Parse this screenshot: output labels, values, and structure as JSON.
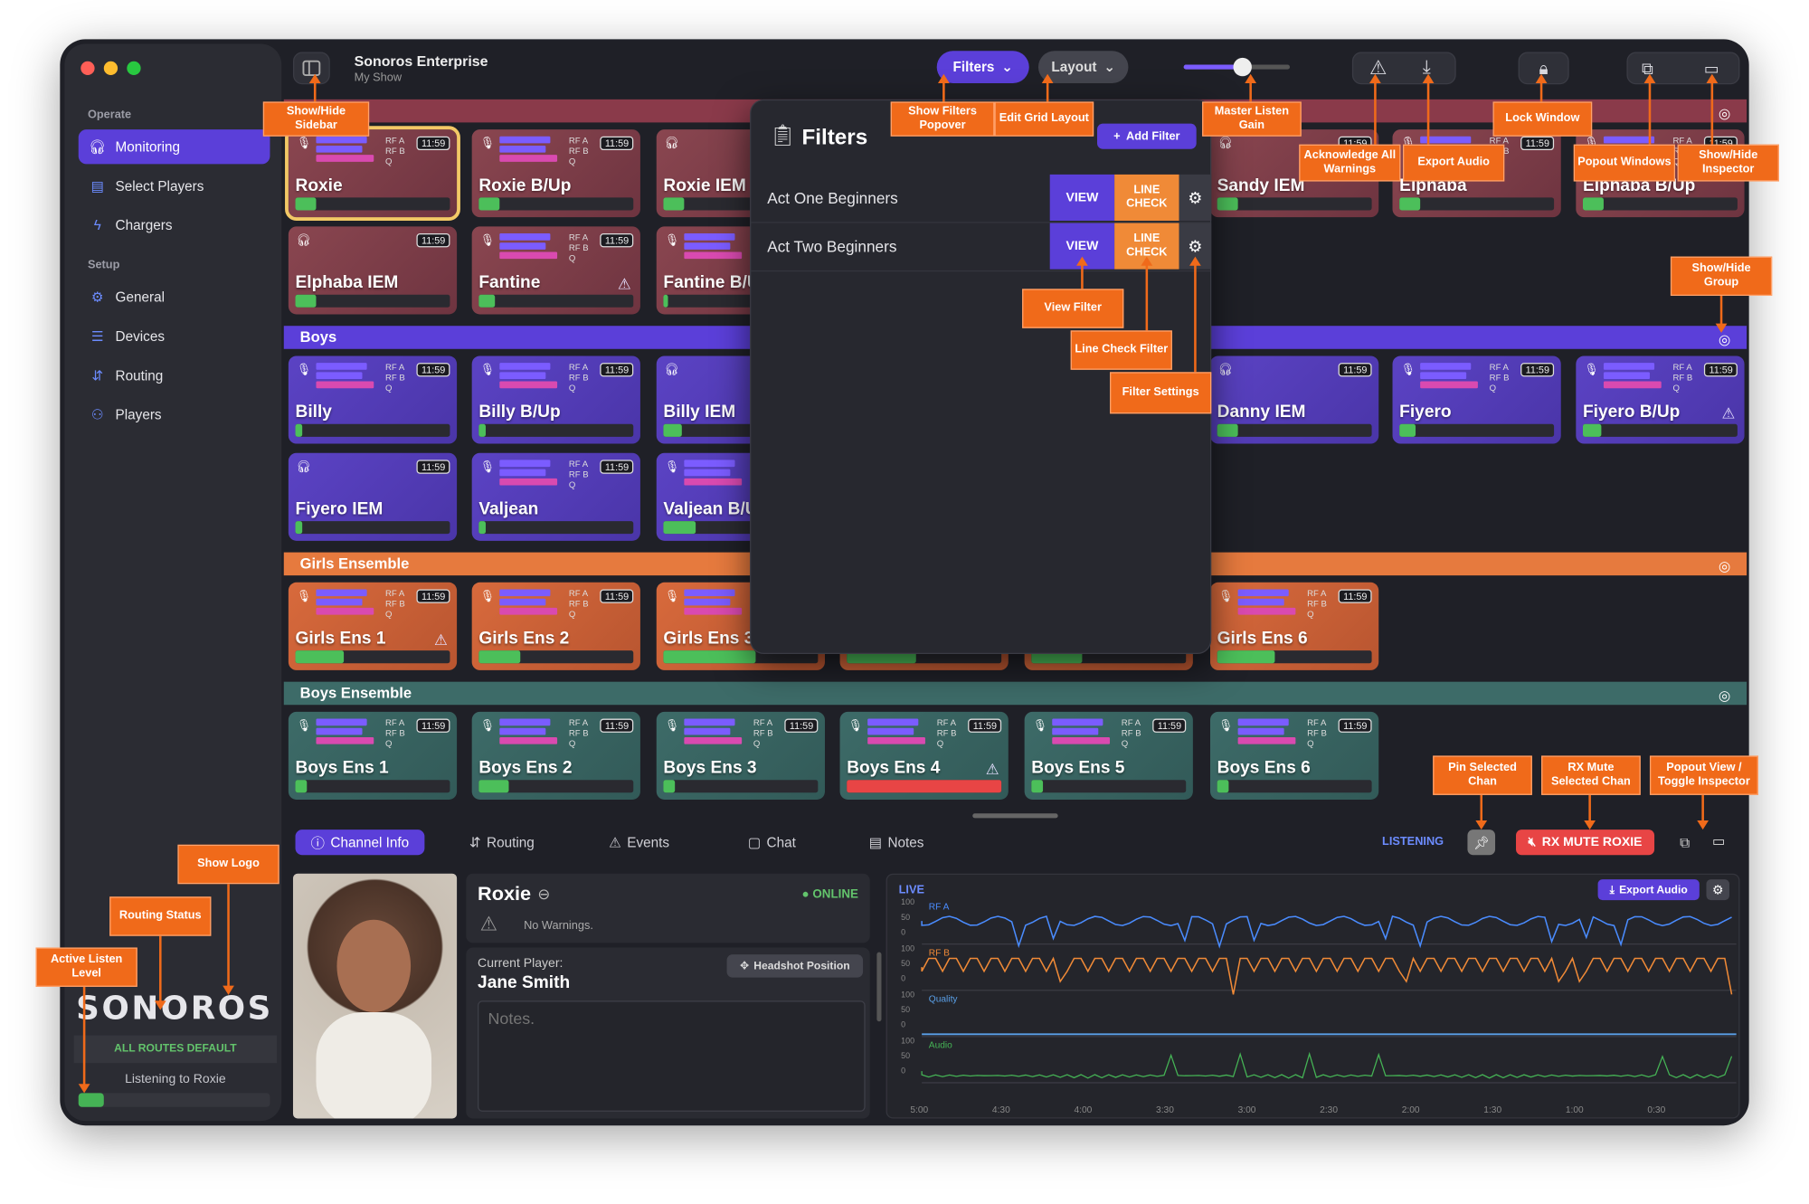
{
  "app": {
    "title": "Sonoros Enterprise",
    "subtitle": "My Show"
  },
  "sidebar": {
    "operate_label": "Operate",
    "setup_label": "Setup",
    "operate": [
      {
        "label": "Monitoring",
        "icon": "headphones-icon"
      },
      {
        "label": "Select Players",
        "icon": "id-card-icon"
      },
      {
        "label": "Chargers",
        "icon": "bolt-icon"
      }
    ],
    "setup": [
      {
        "label": "General",
        "icon": "gear-icon"
      },
      {
        "label": "Devices",
        "icon": "server-icon"
      },
      {
        "label": "Routing",
        "icon": "routing-icon"
      },
      {
        "label": "Players",
        "icon": "user-plus-icon"
      }
    ],
    "logo": "SONOROS",
    "routes_status": "ALL ROUTES DEFAULT",
    "listening": "Listening to Roxie",
    "listen_level": 0.13
  },
  "toolbar": {
    "filters": "Filters",
    "layout": "Layout",
    "gain": 0.55
  },
  "groups": {
    "boys": "Boys",
    "girls": "Girls Ensemble",
    "boys_ens": "Boys Ensemble"
  },
  "tile_labels": {
    "rfa": "RF A",
    "rfb": "RF B",
    "q": "Q",
    "time": "11:59"
  },
  "tiles": {
    "row1": [
      "Roxie",
      "Roxie B/Up",
      "Roxie IEM",
      "Sandy IEM",
      "Elphaba",
      "Elphaba B/Up"
    ],
    "row2": [
      "Elphaba IEM",
      "Fantine",
      "Fantine B/U"
    ],
    "boys1": [
      "Billy",
      "Billy B/Up",
      "Billy IEM",
      "Danny IEM",
      "Fiyero",
      "Fiyero B/Up"
    ],
    "boys2": [
      "Fiyero IEM",
      "Valjean",
      "Valjean B/U"
    ],
    "girls": [
      "Girls Ens 1",
      "Girls Ens 2",
      "Girls Ens 3",
      "Girls Ens 6"
    ],
    "boysens": [
      "Boys Ens 1",
      "Boys Ens 2",
      "Boys Ens 3",
      "Boys Ens 4",
      "Boys Ens 5",
      "Boys Ens 6"
    ]
  },
  "filters": {
    "title": "Filters",
    "add": "Add Filter",
    "view": "VIEW",
    "line_check": "LINE CHECK",
    "rows": [
      "Act One Beginners",
      "Act Two Beginners"
    ]
  },
  "tabs": [
    "Channel Info",
    "Routing",
    "Events",
    "Chat",
    "Notes"
  ],
  "status": {
    "listening": "LISTENING",
    "rx_mute": "RX MUTE ROXIE"
  },
  "channel": {
    "name": "Roxie",
    "online": "ONLINE",
    "warnings": "No Warnings.",
    "current_player_label": "Current Player:",
    "player": "Jane Smith",
    "headshot": "Headshot Position",
    "notes_placeholder": "Notes."
  },
  "graph": {
    "live": "LIVE",
    "export": "Export Audio",
    "tracks": [
      "RF A",
      "RF B",
      "Quality",
      "Audio"
    ],
    "ticks": [
      "100",
      "50",
      "0"
    ],
    "time": [
      "5:00",
      "4:30",
      "4:00",
      "3:30",
      "3:00",
      "2:30",
      "2:00",
      "1:30",
      "1:00",
      "0:30"
    ]
  },
  "annotations": {
    "sidebar": "Show/Hide Sidebar",
    "filters": "Show Filters Popover",
    "layout": "Edit Grid Layout",
    "gain": "Master Listen Gain",
    "lock": "Lock Window",
    "ack": "Acknowledge All Warnings",
    "export": "Export Audio",
    "popout": "Popout Windows",
    "inspector": "Show/Hide Inspector",
    "group": "Show/Hide Group",
    "view": "View Filter",
    "line": "Line Check Filter",
    "settings": "Filter Settings",
    "pin": "Pin Selected Chan",
    "rxmute": "RX Mute Selected Chan",
    "popview": "Popout View / Toggle Inspector",
    "logo": "Show Logo",
    "routing": "Routing Status",
    "active": "Active Listen Level"
  },
  "colors": {
    "accent": "#5b3fd9",
    "annotation": "#f06a1a",
    "live": "#4a8cff"
  }
}
